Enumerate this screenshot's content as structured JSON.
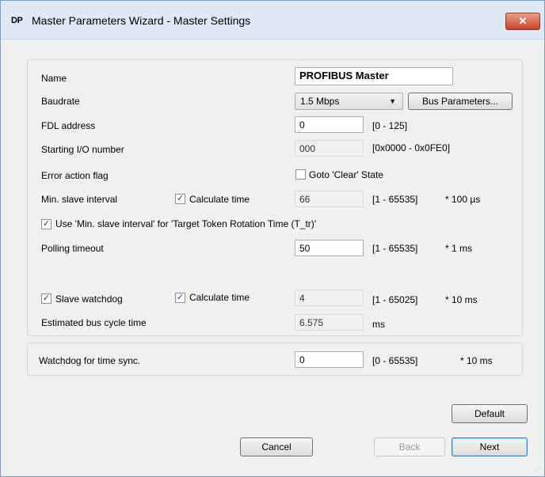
{
  "window": {
    "icon_text": "DP",
    "title": "Master Parameters Wizard - Master Settings",
    "close_glyph": "✕"
  },
  "fields": {
    "name": {
      "label": "Name",
      "value": "PROFIBUS Master"
    },
    "baudrate": {
      "label": "Baudrate",
      "value": "1.5 Mbps",
      "bus_button": "Bus Parameters..."
    },
    "fdl": {
      "label": "FDL address",
      "value": "0",
      "range": "[0 - 125]"
    },
    "io": {
      "label": "Starting I/O number",
      "value": "000",
      "range": "[0x0000 - 0x0FE0]"
    },
    "error_flag": {
      "label": "Error action flag",
      "checkbox_label": "Goto 'Clear' State",
      "checked": false
    },
    "min_slave": {
      "label": "Min. slave interval",
      "calc_label": "Calculate time",
      "calc_checked": true,
      "value": "66",
      "range": "[1 - 65535]",
      "unit": "* 100 µs"
    },
    "use_min_slave": {
      "label": "Use 'Min. slave interval' for 'Target Token Rotation Time (T_tr)'",
      "checked": true
    },
    "polling": {
      "label": "Polling timeout",
      "value": "50",
      "range": "[1 - 65535]",
      "unit": "* 1 ms"
    },
    "watchdog": {
      "label": "Slave watchdog",
      "checked": true,
      "calc_label": "Calculate time",
      "calc_checked": true,
      "value": "4",
      "range": "[1 - 65025]",
      "unit": "* 10 ms"
    },
    "bus_cycle": {
      "label": "Estimated bus cycle time",
      "value": "6.575",
      "unit": "ms"
    },
    "time_sync": {
      "label": "Watchdog for time sync.",
      "value": "0",
      "range": "[0 - 65535]",
      "unit": "* 10 ms"
    }
  },
  "buttons": {
    "default": "Default",
    "cancel": "Cancel",
    "back": "Back",
    "next": "Next"
  },
  "colors": {
    "title_bar": "#dfe9f6",
    "close_button": "#c7432b",
    "dialog_bg": "#f0f0f0"
  }
}
